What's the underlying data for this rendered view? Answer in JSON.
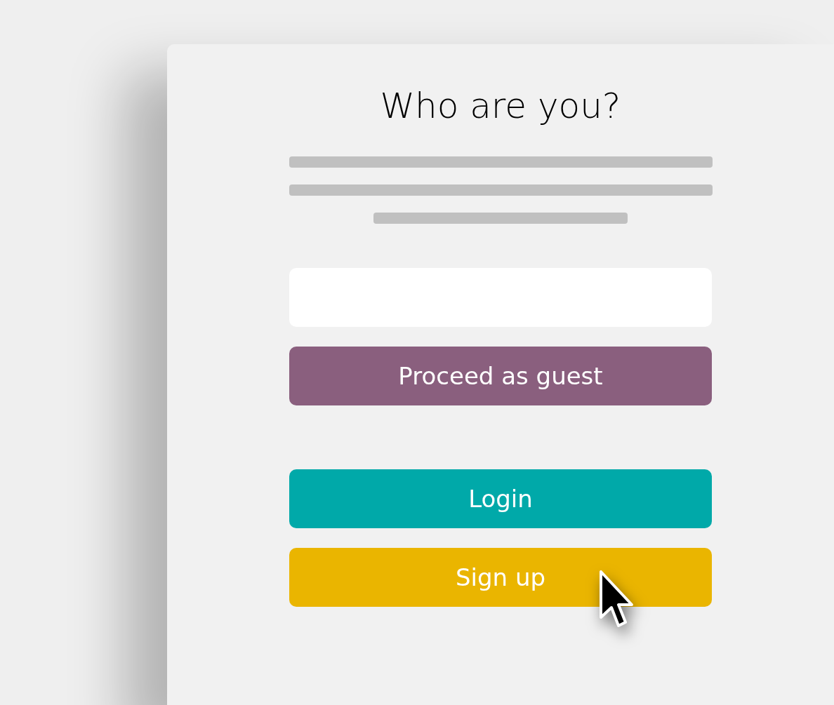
{
  "dialog": {
    "title": "Who are you?",
    "buttons": [
      {
        "label": "Proceed as guest",
        "color": "#8a5f7e"
      },
      {
        "label": "Login",
        "color": "#00a9a9"
      },
      {
        "label": "Sign up",
        "color": "#eab500"
      }
    ]
  }
}
